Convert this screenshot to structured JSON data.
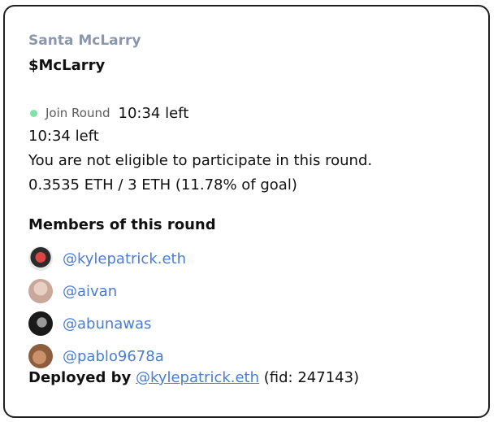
{
  "project": {
    "name": "Santa McLarry",
    "token": "$McLarry"
  },
  "round": {
    "status_label": "Join Round",
    "time_left_inline": "10:34 left",
    "time_left": "10:34 left",
    "eligibility": "You are not eligible to participate in this round.",
    "progress_text": "0.3535 ETH / 3 ETH (11.78% of goal)",
    "progress_fraction": 0.1178,
    "status_dot_color": "#7fe3a6"
  },
  "members": {
    "title": "Members of this round",
    "items": [
      {
        "handle": "@kylepatrick.eth"
      },
      {
        "handle": "@aivan"
      },
      {
        "handle": "@abunawas"
      },
      {
        "handle": "@pablo9678a"
      }
    ]
  },
  "deployed": {
    "label": "Deployed by",
    "handle": "@kylepatrick.eth",
    "fid_text": "(fid: 247143)"
  },
  "colors": {
    "link": "#4a7dd6",
    "project_name": "#8a97ad",
    "border": "#1f1f1f"
  }
}
